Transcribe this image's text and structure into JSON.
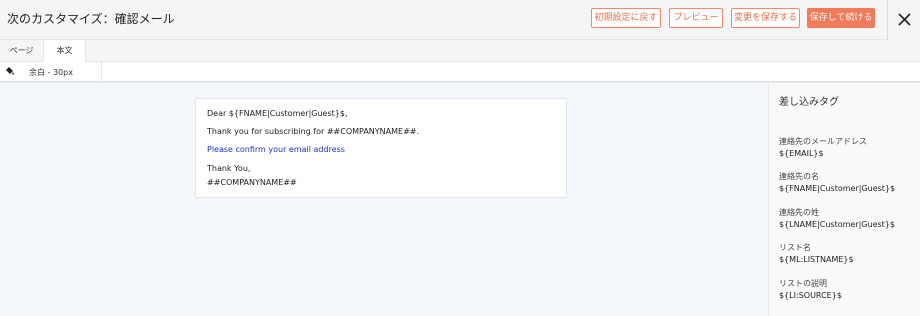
{
  "header": {
    "title": "次のカスタマイズ：確認メール",
    "buttons": {
      "reset": "初期設定に戻す",
      "preview": "プレビュー",
      "save": "変更を保存する",
      "save_continue": "保存して続ける"
    },
    "close_icon": "close-icon"
  },
  "tabs": [
    {
      "label": "ページ",
      "active": false
    },
    {
      "label": "本文",
      "active": true
    }
  ],
  "properties": {
    "icon": "paint-bucket-icon",
    "padding_label": "余白 - 30px"
  },
  "email": {
    "greeting": "Dear ${FNAME|Customer|Guest}$,",
    "thanks_line": "Thank you for subscribing for ##COMPANYNAME##.",
    "confirm_link": "Please confirm your email address",
    "closing": "Thank You,",
    "signature": "##COMPANYNAME##"
  },
  "merge_tags": {
    "title": "差し込みタグ",
    "items": [
      {
        "label": "連絡先のメールアドレス",
        "value": "${EMAIL}$"
      },
      {
        "label": "連絡先の名",
        "value": "${FNAME|Customer|Guest}$"
      },
      {
        "label": "連絡先の姓",
        "value": "${LNAME|Customer|Guest}$"
      },
      {
        "label": "リスト名",
        "value": "${ML:LISTNAME}$"
      },
      {
        "label": "リストの説明",
        "value": "${LI:SOURCE}$"
      }
    ]
  },
  "colors": {
    "accent": "#f07a59",
    "link": "#1e2fd6"
  }
}
